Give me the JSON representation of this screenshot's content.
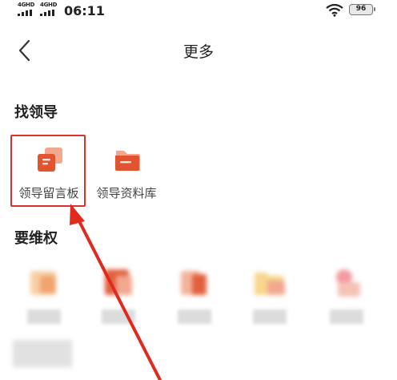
{
  "status_bar": {
    "network_1": "4GHD",
    "network_2": "4GHD",
    "time": "06:11",
    "battery": "96"
  },
  "header": {
    "back_icon": "chevron-left-icon",
    "title": "更多"
  },
  "sections": {
    "find_leader": {
      "title": "找领导",
      "items": [
        {
          "label": "领导留言板",
          "icon": "message-board-icon",
          "color": "#e2542f"
        },
        {
          "label": "领导资料库",
          "icon": "folder-icon",
          "color": "#e2542f"
        }
      ]
    },
    "rights": {
      "title": "要维权"
    }
  },
  "colors": {
    "accent": "#e2542f",
    "highlight": "#d9302b"
  }
}
